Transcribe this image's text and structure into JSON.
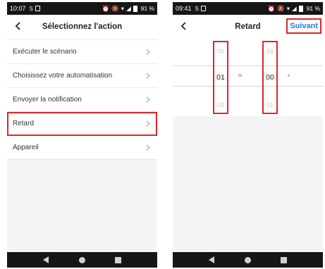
{
  "left_screen": {
    "status": {
      "time": "10:07",
      "battery": "91 %"
    },
    "title": "Sélectionnez l'action",
    "items": [
      {
        "label": "Exécuter le scénario"
      },
      {
        "label": "Choisissez votre automatisation"
      },
      {
        "label": "Envoyer la notification"
      },
      {
        "label": "Retard",
        "highlighted": true
      },
      {
        "label": "Appareil"
      }
    ]
  },
  "right_screen": {
    "status": {
      "time": "09:41",
      "battery": "91 %"
    },
    "title": "Retard",
    "next_label": "Suivant",
    "picker": {
      "minutes": {
        "prev": "00",
        "current": "01",
        "next": "02",
        "unit": "m"
      },
      "seconds": {
        "prev": "59",
        "current": "00",
        "next": "01",
        "unit": "s"
      }
    }
  },
  "colors": {
    "highlight": "#e0262b",
    "accent": "#1e7fd6",
    "bars": "#161616"
  },
  "icons": [
    "back-icon",
    "chevron-right-icon",
    "nav-back-icon",
    "nav-home-icon",
    "nav-recents-icon"
  ]
}
